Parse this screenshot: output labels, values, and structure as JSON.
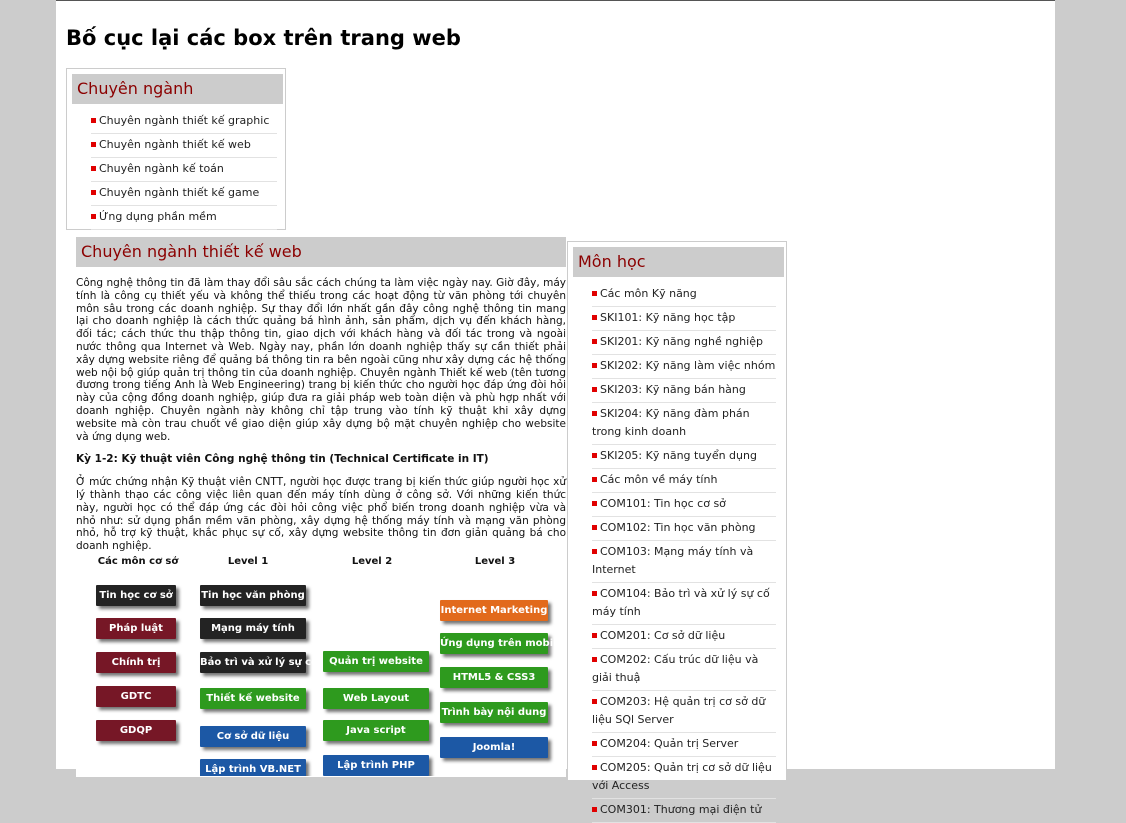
{
  "page": {
    "title": "Bố cục lại các box trên trang web"
  },
  "majors": {
    "heading": "Chuyên ngành",
    "items": [
      {
        "label": "Chuyên ngành thiết kế graphic"
      },
      {
        "label": "Chuyên ngành thiết kế web"
      },
      {
        "label": "Chuyên ngành kế toán"
      },
      {
        "label": "Chuyên ngành thiết kế game"
      },
      {
        "label": "Ứng dụng phần mềm"
      }
    ]
  },
  "main": {
    "heading": "Chuyên ngành thiết kế web",
    "intro": "Công nghệ thông tin đã làm thay đổi sâu sắc cách chúng ta làm việc ngày nay. Giờ đây, máy tính là công cụ thiết yếu và không thể thiếu trong các hoạt động từ văn phòng tới chuyên môn sâu trong các doanh nghiệp. Sự thay đổi lớn nhất gần đây công nghệ thông tin mang lại cho doanh nghiệp là cách thức quảng bá hình ảnh, sản phẩm, dịch vụ đến khách hàng, đối tác; cách thức thu thập thông tin, giao dịch với khách hàng và đối tác trong và ngoài nước thông qua Internet và Web. Ngày nay, phần lớn doanh nghiệp thấy sự cần thiết phải xây dựng website riêng để quảng bá thông tin ra bên ngoài cũng như xây dựng các hệ thống web nội bộ giúp quản trị thông tin của doanh nghiệp. Chuyên ngành Thiết kế web (tên tương đương trong tiếng Anh là Web Engineering) trang bị kiến thức cho người học đáp ứng đòi hỏi này của cộng đồng doanh nghiệp, giúp đưa ra giải pháp web toàn diện và phù hợp nhất với doanh nghiệp. Chuyên ngành này không chỉ tập trung vào tính kỹ thuật khi xây dựng website mà còn trau chuốt về giao diện giúp xây dựng bộ mặt chuyên nghiệp cho website và ứng dụng web.",
    "subheading": "Kỳ 1-2: Kỹ thuật viên Công nghệ thông tin (Technical Certificate in IT)",
    "paragraph2": "Ở mức chứng nhận Kỹ thuật viên CNTT, người học được trang bị kiến thức giúp người học xử lý thành thạo các công việc liên quan đến máy tính dùng ở công sở. Với những kiến thức này, người học có thể đáp ứng các đòi hỏi công việc phổ biến trong doanh nghiệp vừa và nhỏ như: sử dụng phần mềm văn phòng, xây dựng hệ thống máy tính và mạng văn phòng nhỏ, hỗ trợ kỹ thuật, khắc phục sự cố, xây dựng website thông tin đơn giản quảng bá cho doanh nghiệp."
  },
  "diagram": {
    "columns": [
      "Các môn cơ sở",
      "Level 1",
      "Level 2",
      "Level 3"
    ],
    "chips": {
      "c0_0": "Tin học cơ sở",
      "c0_1": "Pháp luật",
      "c0_2": "Chính trị",
      "c0_3": "GDTC",
      "c0_4": "GDQP",
      "c1_0": "Tin học văn phòng",
      "c1_1": "Mạng máy tính",
      "c1_2": "Bảo trì và xử lý sự cố",
      "c1_3": "Thiết kế website",
      "c1_4": "Cơ sở dữ liệu",
      "c1_5": "Lập trình VB.NET",
      "c2_0": "Quản trị website",
      "c2_1": "Web Layout",
      "c2_2": "Java script",
      "c2_3": "Lập trình PHP",
      "c3_0": "Internet Marketing",
      "c3_1": "Ứng dụng trên mobile",
      "c3_2": "HTML5 & CSS3",
      "c3_3": "Trình bày nội dung",
      "c3_4": "Joomla!"
    },
    "colors": {
      "black": "#232323",
      "red": "#761726",
      "green": "#2e9a1e",
      "orange": "#e26a1c",
      "blue": "#1c58a5"
    }
  },
  "subjects": {
    "heading": "Môn học",
    "items": [
      {
        "label": "Các môn Kỹ năng"
      },
      {
        "label": "SKI101: Kỹ năng học tập"
      },
      {
        "label": "SKI201: Kỹ năng nghề nghiệp"
      },
      {
        "label": "SKI202: Kỹ năng làm việc nhóm"
      },
      {
        "label": "SKI203: Kỹ năng bán hàng"
      },
      {
        "label": "SKI204: Kỹ năng đàm phán trong kinh doanh"
      },
      {
        "label": "SKI205: Kỹ năng tuyển dụng"
      },
      {
        "label": "Các môn về máy tính"
      },
      {
        "label": "COM101: Tin học cơ sở"
      },
      {
        "label": "COM102: Tin học văn phòng"
      },
      {
        "label": "COM103: Mạng máy tính và Internet"
      },
      {
        "label": "COM104: Bảo trì và xử lý sự cố máy tính"
      },
      {
        "label": "COM201: Cơ sở dữ liệu"
      },
      {
        "label": "COM202: Cấu trúc dữ liệu và giải thuậ"
      },
      {
        "label": "COM203: Hệ quản trị cơ sở dữ liệu SQl Server"
      },
      {
        "label": "COM204: Quản trị Server"
      },
      {
        "label": "COM205: Quản trị cơ sở dữ liệu với Access"
      },
      {
        "label": "COM301: Thương mại điện tử"
      }
    ]
  }
}
